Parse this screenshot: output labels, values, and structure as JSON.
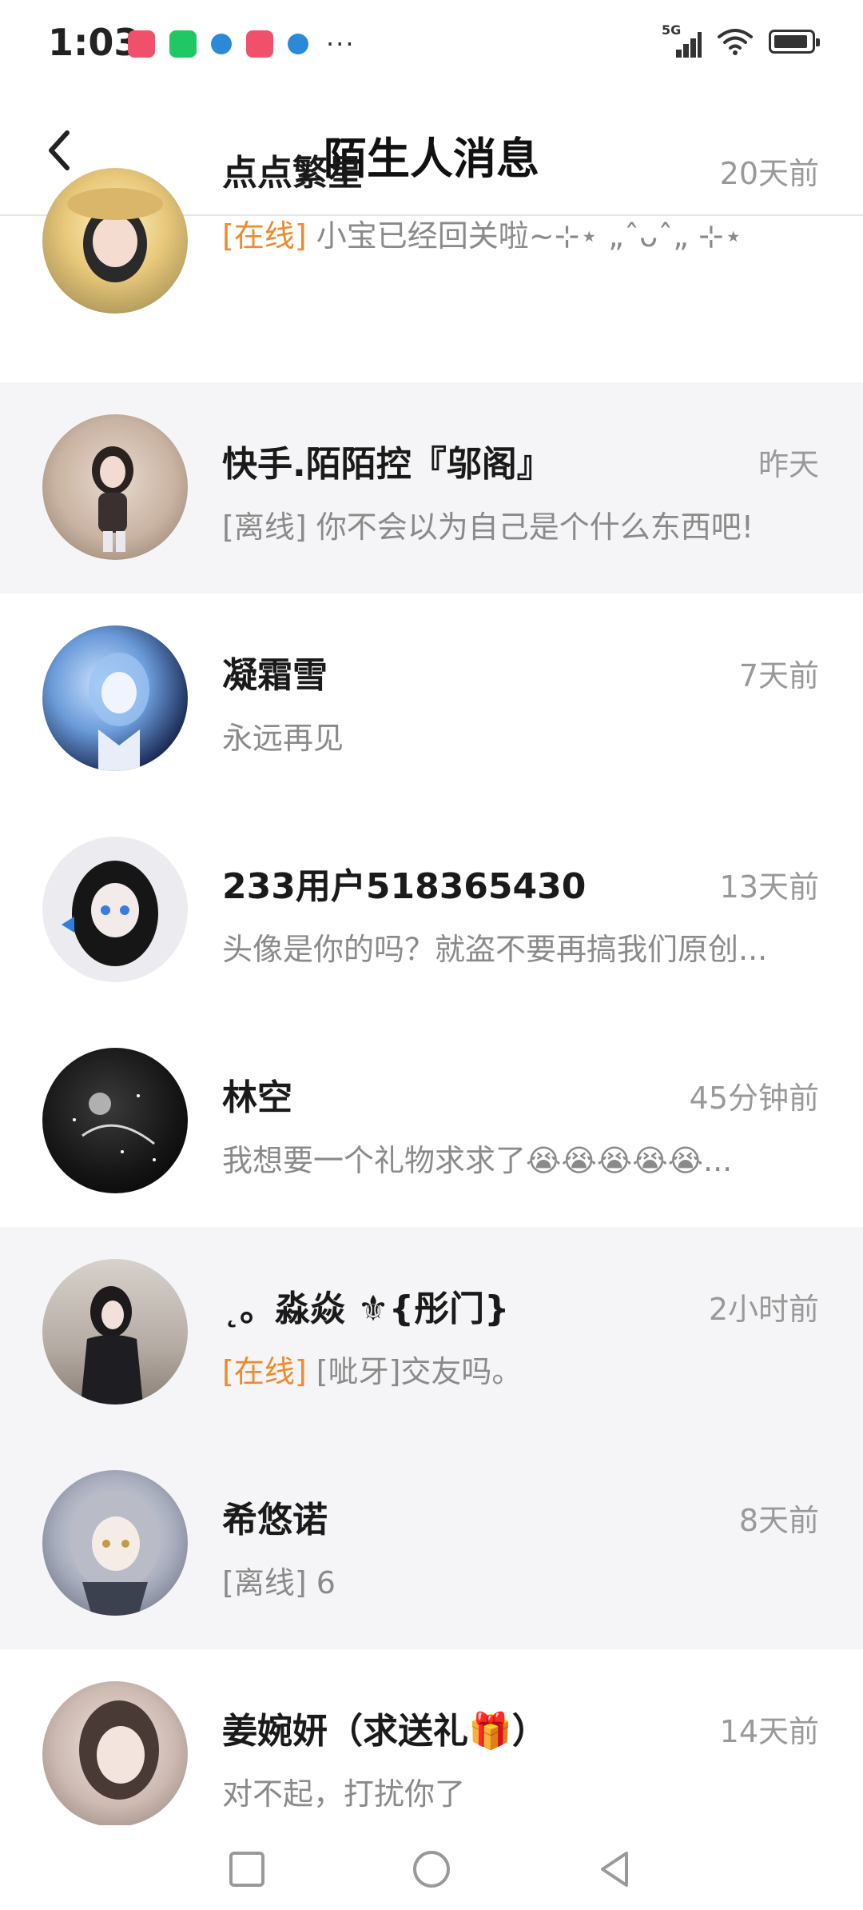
{
  "status_bar": {
    "time": "1:03",
    "network": "5G",
    "app_icons": [
      "red-app-icon",
      "wechat-icon",
      "globe-icon",
      "red-app-icon",
      "globe-icon"
    ],
    "more": "···"
  },
  "header": {
    "title": "陌生人消息"
  },
  "colors": {
    "online_tag": "#f08a2a",
    "muted_text": "#8a8a8a",
    "row_shade": "#f5f5f7"
  },
  "conversations": [
    {
      "name": "点点繁星",
      "time": "20天前",
      "status": "[在线]",
      "message": "小宝已经回关啦~⊹⋆ „ˆᴗˆ„ ⊹⋆",
      "shaded": false
    },
    {
      "name": "快手.陌陌控『邬阁』",
      "time": "昨天",
      "status": "[离线]",
      "message": "你不会以为自己是个什么东西吧!",
      "shaded": true
    },
    {
      "name": "凝霜雪",
      "time": "7天前",
      "status": "",
      "message": "永远再见",
      "shaded": false
    },
    {
      "name": "233用户518365430",
      "time": "13天前",
      "status": "",
      "message": "头像是你的吗？就盗不要再搞我们原创...",
      "shaded": false
    },
    {
      "name": "林空",
      "time": "45分钟前",
      "status": "",
      "message": "我想要一个礼物求求了😭😭😭😭😭...",
      "shaded": false
    },
    {
      "name": "˛。淼焱 ⚜{彤门}",
      "time": "2小时前",
      "status": "[在线]",
      "message": "[呲牙]交友吗。",
      "shaded": true
    },
    {
      "name": "希悠诺",
      "time": "8天前",
      "status": "[离线]",
      "message": "6",
      "shaded": true
    },
    {
      "name": "姜婉妍（求送礼🎁）",
      "time": "14天前",
      "status": "",
      "message": "对不起，打扰你了",
      "shaded": false
    }
  ],
  "nav": {
    "buttons": [
      "recents-square-icon",
      "home-circle-icon",
      "back-triangle-icon"
    ]
  }
}
